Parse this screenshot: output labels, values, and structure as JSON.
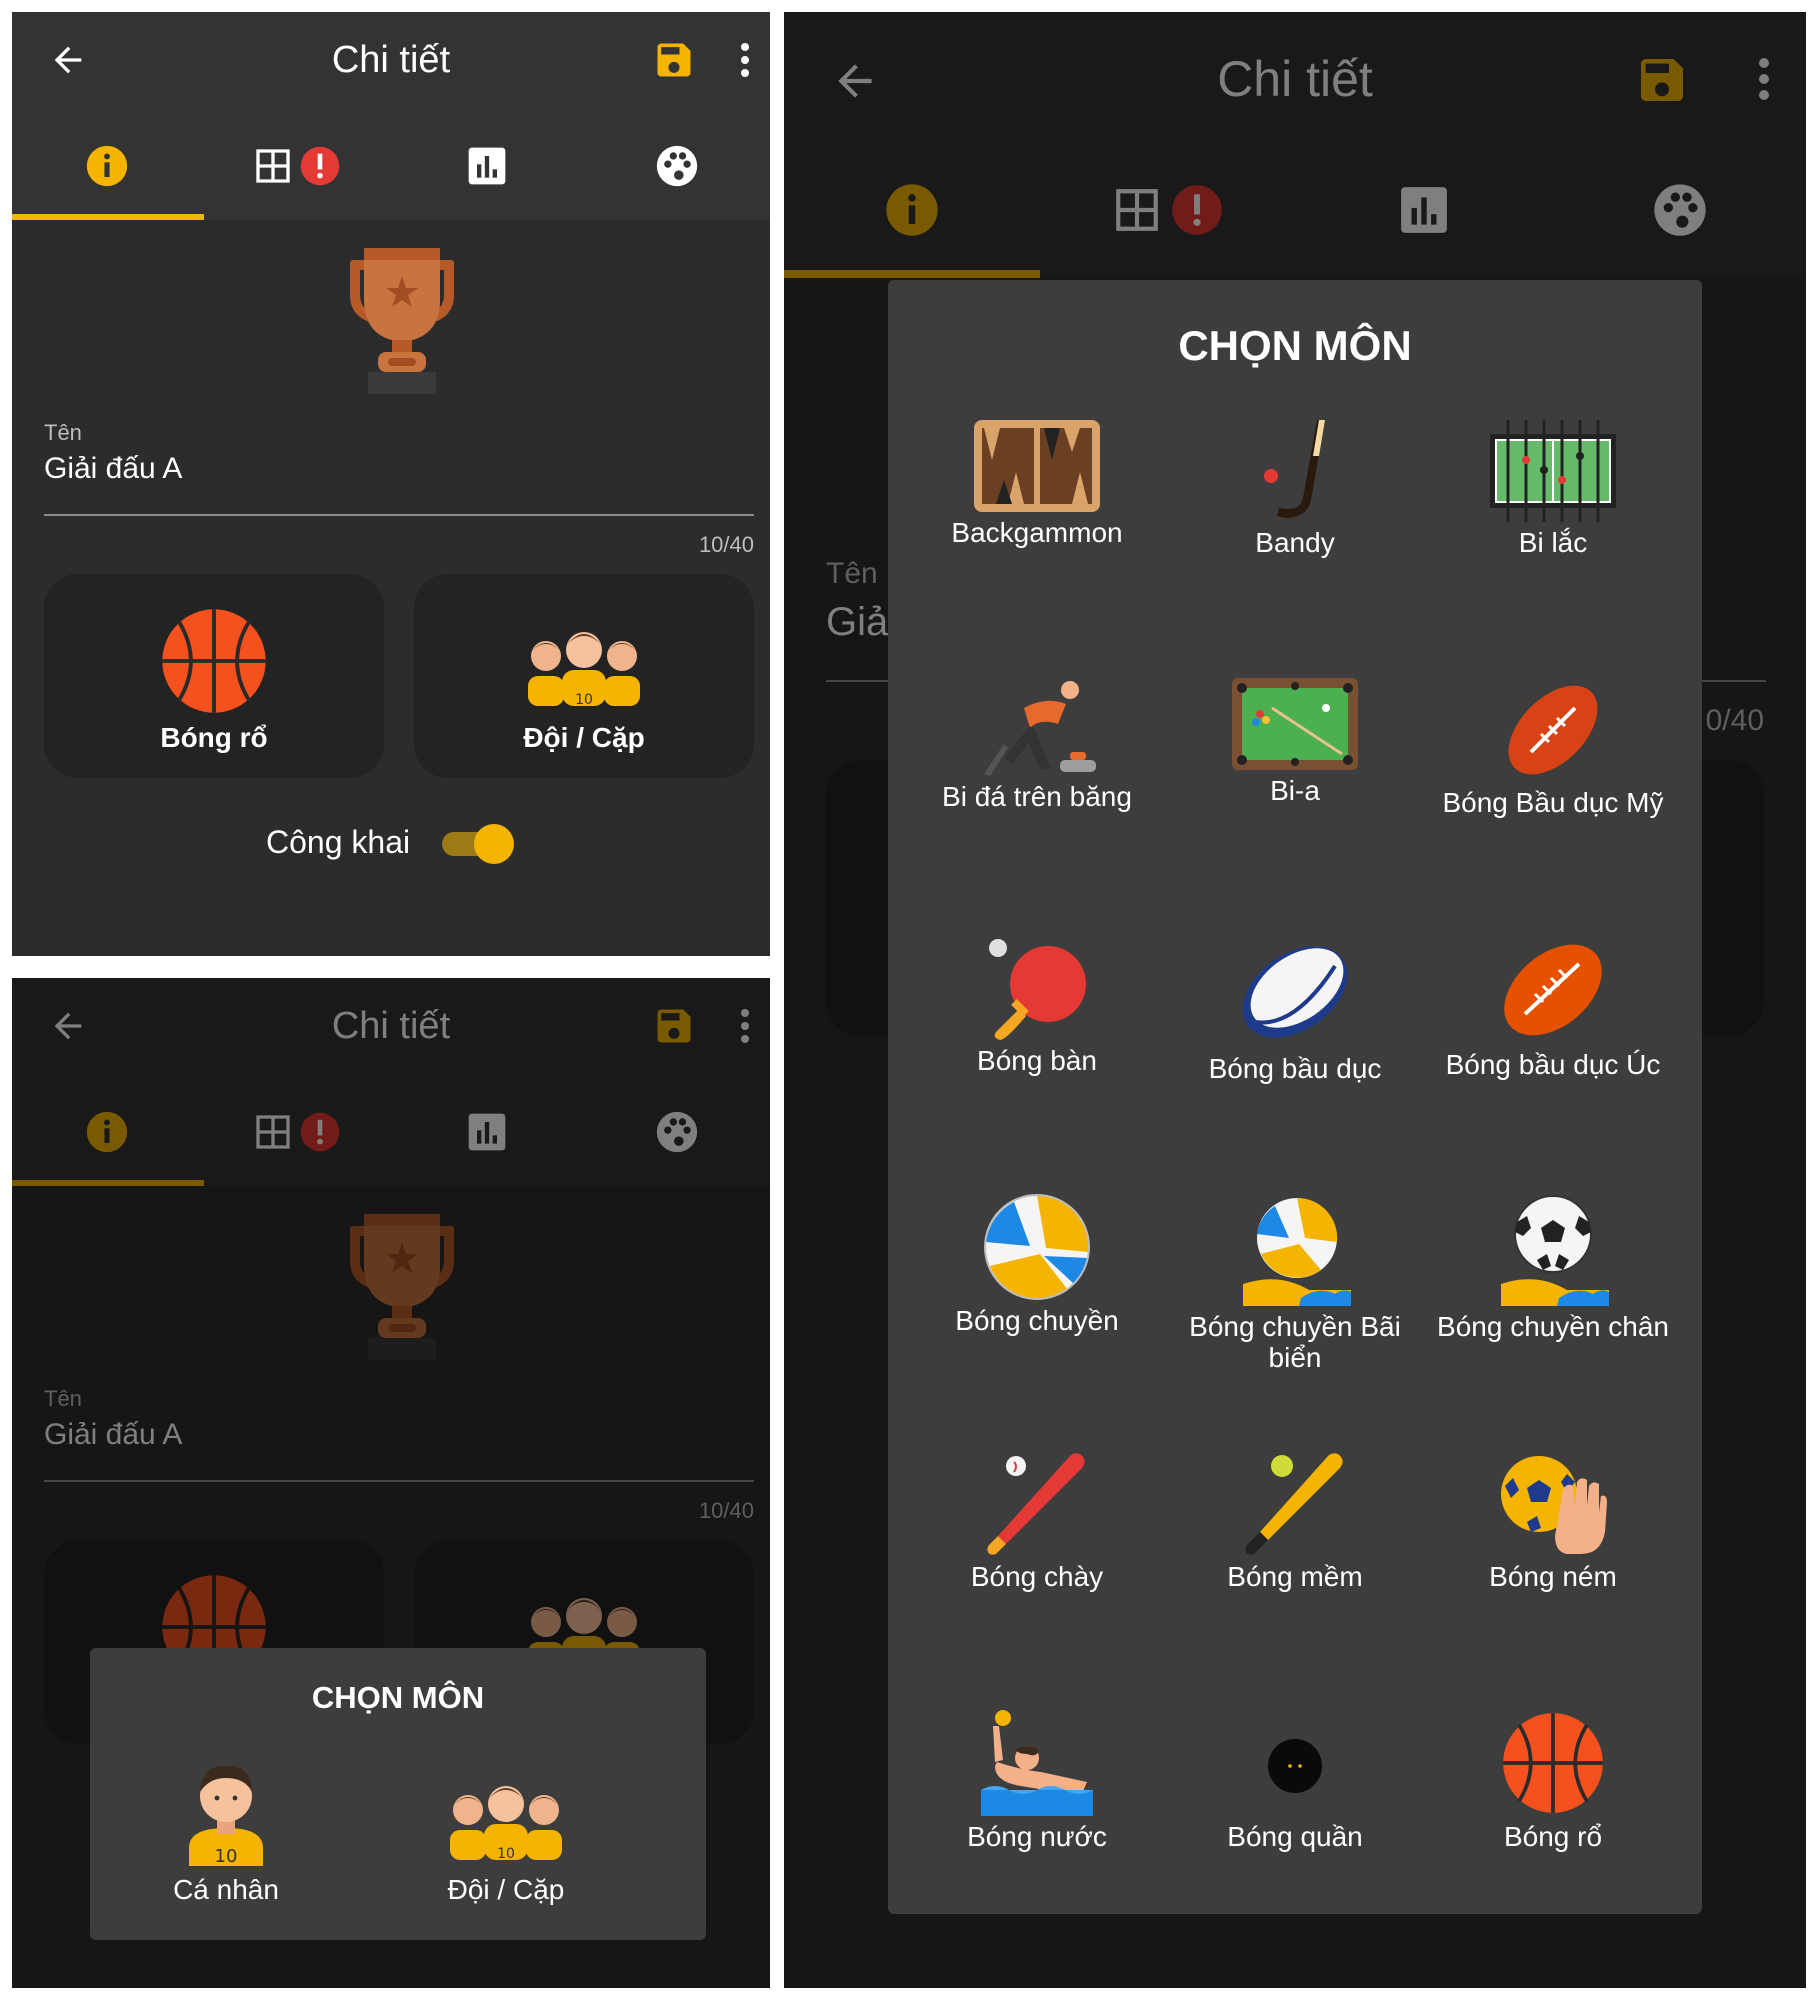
{
  "header": {
    "title": "Chi tiết"
  },
  "tabs": [
    {
      "name": "info-tab",
      "icon": "info-icon"
    },
    {
      "name": "bracket-tab",
      "icon": "grid-icon",
      "badge": "!"
    },
    {
      "name": "stats-tab",
      "icon": "bar-chart-icon"
    },
    {
      "name": "participants-tab",
      "icon": "palette-icon"
    }
  ],
  "form": {
    "name_label": "Tên",
    "name_value": "Giải đấu A",
    "partial_label": "Tên",
    "partial_value": "Giả",
    "counter": "10/40",
    "partial_counter": "0/40",
    "sport_card_label": "Bóng rổ",
    "type_card_label": "Đội / Cặp",
    "public_label": "Công khai",
    "public_on": true
  },
  "mode_dialog": {
    "title": "CHỌN MÔN",
    "options": [
      "Cá nhân",
      "Đội / Cặp"
    ]
  },
  "sport_dialog": {
    "title": "CHỌN MÔN",
    "sports": [
      "Backgammon",
      "Bandy",
      "Bi lắc",
      "Bi đá trên băng",
      "Bi-a",
      "Bóng Bầu dục Mỹ",
      "Bóng bàn",
      "Bóng bầu dục",
      "Bóng bầu dục Úc",
      "Bóng chuyền",
      "Bóng chuyền Bãi biển",
      "Bóng chuyền chân",
      "Bóng chày",
      "Bóng mềm",
      "Bóng ném",
      "Bóng nước",
      "Bóng quần",
      "Bóng rổ"
    ]
  },
  "colors": {
    "accent": "#f5b400",
    "badge": "#e53935",
    "background": "#2c2c2c",
    "appbar": "#333333"
  }
}
